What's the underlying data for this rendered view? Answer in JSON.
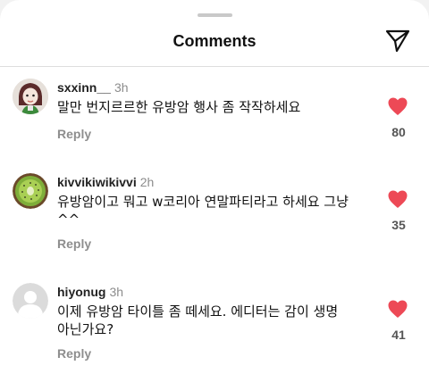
{
  "header": {
    "title": "Comments",
    "share_icon": "send-icon"
  },
  "colors": {
    "heart": "#ed4956",
    "muted": "#8e8e8e"
  },
  "comments": [
    {
      "username": "sxxinn__",
      "time": "3h",
      "text": "말만 번지르르한 유방암 행사 좀 작작하세요",
      "reply_label": "Reply",
      "likes": "80"
    },
    {
      "username": "kivvikiwikivvi",
      "time": "2h",
      "text": "유방암이고 뭐고 w코리아 연말파티라고 하세요 그냥 ^^",
      "reply_label": "Reply",
      "likes": "35"
    },
    {
      "username": "hiyonug",
      "time": "3h",
      "text": "이제 유방암 타이틀 좀 떼세요. 에디터는 감이 생명 아닌가요?",
      "reply_label": "Reply",
      "likes": "41"
    }
  ]
}
